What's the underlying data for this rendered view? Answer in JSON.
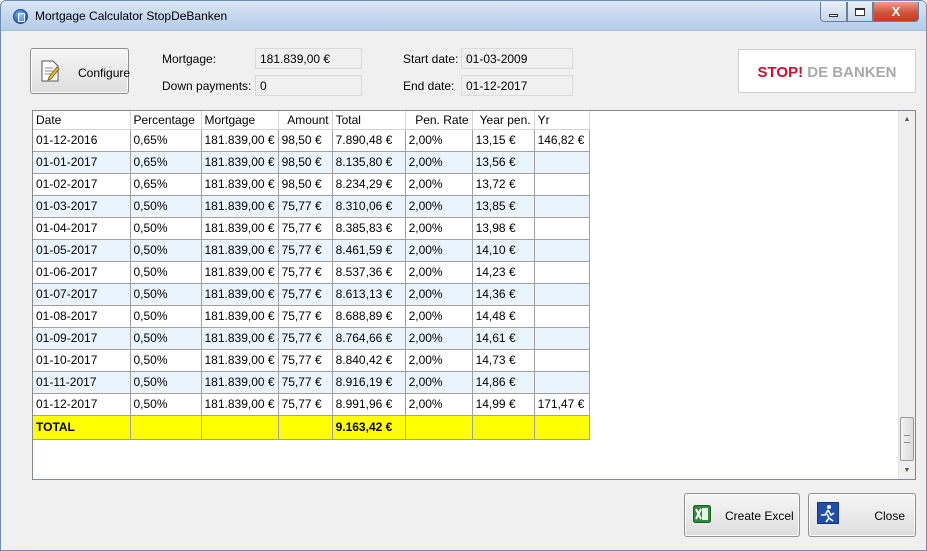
{
  "window": {
    "title": "Mortgage Calculator StopDeBanken",
    "controls": {
      "minimize_icon": "minimize-icon",
      "maximize_icon": "maximize-icon",
      "close_glyph": "X"
    }
  },
  "toolbar": {
    "configure_label": "Configure",
    "configure_icon": "document-edit-icon"
  },
  "info": {
    "mortgage_label": "Mortgage:",
    "mortgage_value": "181.839,00 €",
    "down_payments_label": "Down payments:",
    "down_payments_value": "0",
    "start_date_label": "Start date:",
    "start_date_value": "01-03-2009",
    "end_date_label": "End date:",
    "end_date_value": "01-12-2017"
  },
  "logo": {
    "stop": "STOP!",
    "banken": " DE BANKEN"
  },
  "grid": {
    "columns": [
      "Date",
      "Percentage",
      "Mortgage",
      "Amount",
      "Total",
      "Pen. Rate",
      "Year pen.",
      "Yr"
    ],
    "rows": [
      [
        "01-12-2016",
        "0,65%",
        "181.839,00 €",
        "98,50 €",
        "7.890,48 €",
        "2,00%",
        "13,15 €",
        "146,82 €"
      ],
      [
        "01-01-2017",
        "0,65%",
        "181.839,00 €",
        "98,50 €",
        "8.135,80 €",
        "2,00%",
        "13,56 €",
        ""
      ],
      [
        "01-02-2017",
        "0,65%",
        "181.839,00 €",
        "98,50 €",
        "8.234,29 €",
        "2,00%",
        "13,72 €",
        ""
      ],
      [
        "01-03-2017",
        "0,50%",
        "181.839,00 €",
        "75,77 €",
        "8.310,06 €",
        "2,00%",
        "13,85 €",
        ""
      ],
      [
        "01-04-2017",
        "0,50%",
        "181.839,00 €",
        "75,77 €",
        "8.385,83 €",
        "2,00%",
        "13,98 €",
        ""
      ],
      [
        "01-05-2017",
        "0,50%",
        "181.839,00 €",
        "75,77 €",
        "8.461,59 €",
        "2,00%",
        "14,10 €",
        ""
      ],
      [
        "01-06-2017",
        "0,50%",
        "181.839,00 €",
        "75,77 €",
        "8.537,36 €",
        "2,00%",
        "14,23 €",
        ""
      ],
      [
        "01-07-2017",
        "0,50%",
        "181.839,00 €",
        "75,77 €",
        "8.613,13 €",
        "2,00%",
        "14,36 €",
        ""
      ],
      [
        "01-08-2017",
        "0,50%",
        "181.839,00 €",
        "75,77 €",
        "8.688,89 €",
        "2,00%",
        "14,48 €",
        ""
      ],
      [
        "01-09-2017",
        "0,50%",
        "181.839,00 €",
        "75,77 €",
        "8.764,66 €",
        "2,00%",
        "14,61 €",
        ""
      ],
      [
        "01-10-2017",
        "0,50%",
        "181.839,00 €",
        "75,77 €",
        "8.840,42 €",
        "2,00%",
        "14,73 €",
        ""
      ],
      [
        "01-11-2017",
        "0,50%",
        "181.839,00 €",
        "75,77 €",
        "8.916,19 €",
        "2,00%",
        "14,86 €",
        ""
      ],
      [
        "01-12-2017",
        "0,50%",
        "181.839,00 €",
        "75,77 €",
        "8.991,96 €",
        "2,00%",
        "14,99 €",
        "171,47 €"
      ]
    ],
    "total_row": [
      "TOTAL",
      "",
      "",
      "",
      "9.163,42 €",
      "",
      "",
      ""
    ],
    "total_color": "#ffff00",
    "alt_row_color": "#eaf4fd"
  },
  "buttons": {
    "excel_label": "Create Excel",
    "excel_icon": "excel-icon",
    "close_label": "Close",
    "close_icon": "exit-icon"
  }
}
